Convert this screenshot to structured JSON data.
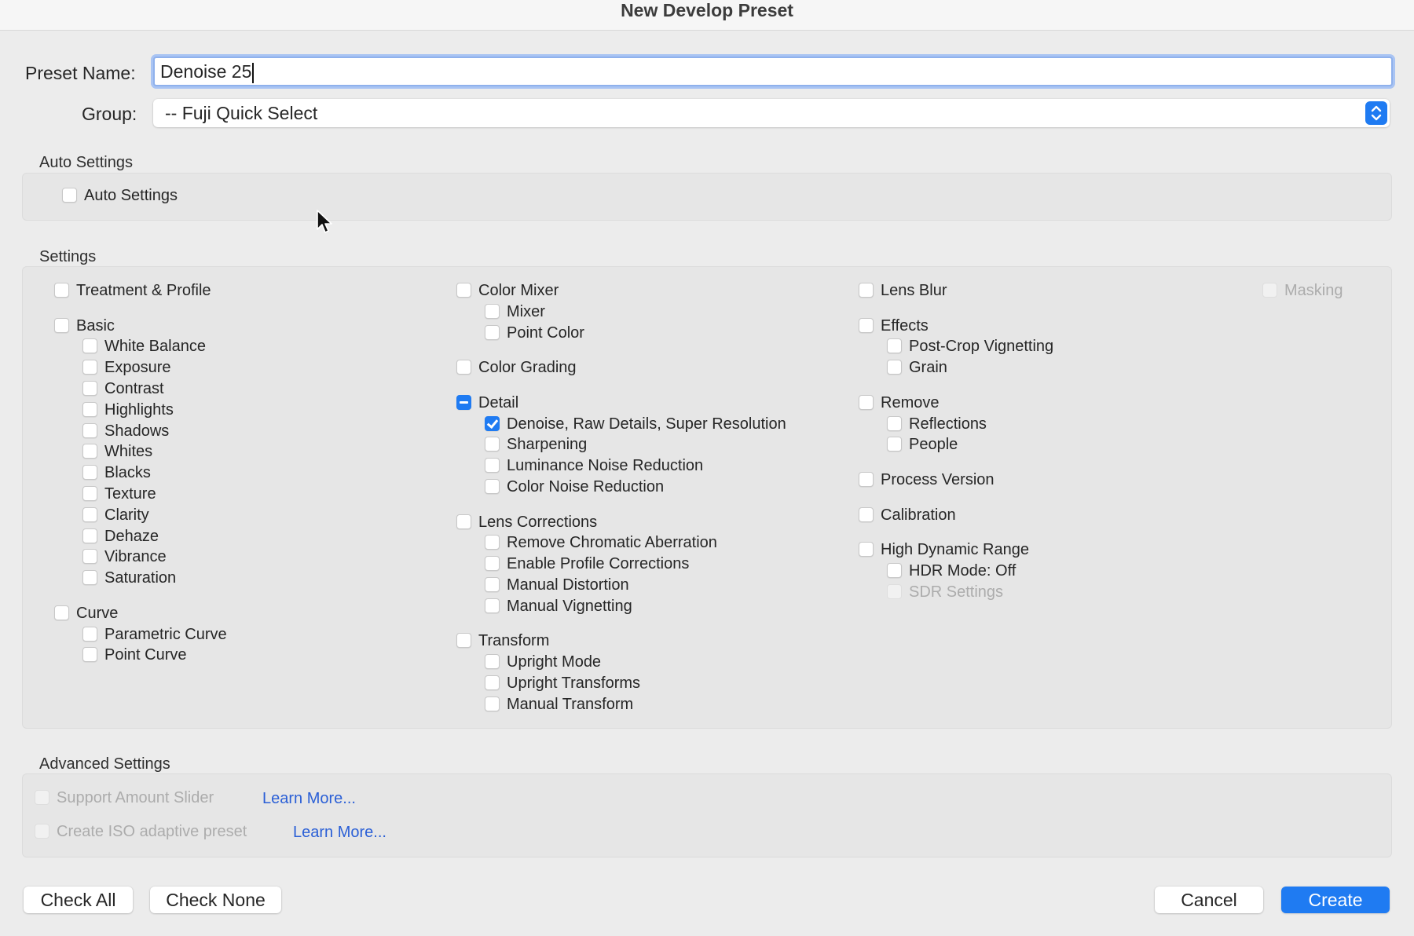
{
  "window": {
    "title": "New Develop Preset"
  },
  "preset_name": {
    "label": "Preset Name:",
    "value": "Denoise 25"
  },
  "group": {
    "label": "Group:",
    "value": "-- Fuji Quick Select"
  },
  "auto_settings": {
    "section_title": "Auto Settings",
    "item": {
      "label": "Auto Settings",
      "checked": false
    }
  },
  "settings": {
    "section_title": "Settings",
    "columns": [
      [
        {
          "label": "Treatment & Profile",
          "level": 0,
          "state": "unchecked"
        },
        {
          "label": "Basic",
          "level": 0,
          "state": "unchecked"
        },
        {
          "label": "White Balance",
          "level": 1,
          "state": "unchecked"
        },
        {
          "label": "Exposure",
          "level": 1,
          "state": "unchecked"
        },
        {
          "label": "Contrast",
          "level": 1,
          "state": "unchecked"
        },
        {
          "label": "Highlights",
          "level": 1,
          "state": "unchecked"
        },
        {
          "label": "Shadows",
          "level": 1,
          "state": "unchecked"
        },
        {
          "label": "Whites",
          "level": 1,
          "state": "unchecked"
        },
        {
          "label": "Blacks",
          "level": 1,
          "state": "unchecked"
        },
        {
          "label": "Texture",
          "level": 1,
          "state": "unchecked"
        },
        {
          "label": "Clarity",
          "level": 1,
          "state": "unchecked"
        },
        {
          "label": "Dehaze",
          "level": 1,
          "state": "unchecked"
        },
        {
          "label": "Vibrance",
          "level": 1,
          "state": "unchecked"
        },
        {
          "label": "Saturation",
          "level": 1,
          "state": "unchecked"
        },
        {
          "label": "Curve",
          "level": 0,
          "state": "unchecked"
        },
        {
          "label": "Parametric Curve",
          "level": 1,
          "state": "unchecked"
        },
        {
          "label": "Point Curve",
          "level": 1,
          "state": "unchecked"
        }
      ],
      [
        {
          "label": "Color Mixer",
          "level": 0,
          "state": "unchecked"
        },
        {
          "label": "Mixer",
          "level": 1,
          "state": "unchecked"
        },
        {
          "label": "Point Color",
          "level": 1,
          "state": "unchecked"
        },
        {
          "label": "Color Grading",
          "level": 0,
          "state": "unchecked"
        },
        {
          "label": "Detail",
          "level": 0,
          "state": "mixed"
        },
        {
          "label": "Denoise, Raw Details, Super Resolution",
          "level": 1,
          "state": "checked"
        },
        {
          "label": "Sharpening",
          "level": 1,
          "state": "unchecked"
        },
        {
          "label": "Luminance Noise Reduction",
          "level": 1,
          "state": "unchecked"
        },
        {
          "label": "Color Noise Reduction",
          "level": 1,
          "state": "unchecked"
        },
        {
          "label": "Lens Corrections",
          "level": 0,
          "state": "unchecked"
        },
        {
          "label": "Remove Chromatic Aberration",
          "level": 1,
          "state": "unchecked"
        },
        {
          "label": "Enable Profile Corrections",
          "level": 1,
          "state": "unchecked"
        },
        {
          "label": "Manual Distortion",
          "level": 1,
          "state": "unchecked"
        },
        {
          "label": "Manual Vignetting",
          "level": 1,
          "state": "unchecked"
        },
        {
          "label": "Transform",
          "level": 0,
          "state": "unchecked"
        },
        {
          "label": "Upright Mode",
          "level": 1,
          "state": "unchecked"
        },
        {
          "label": "Upright Transforms",
          "level": 1,
          "state": "unchecked"
        },
        {
          "label": "Manual Transform",
          "level": 1,
          "state": "unchecked"
        }
      ],
      [
        {
          "label": "Lens Blur",
          "level": 0,
          "state": "unchecked"
        },
        {
          "label": "Effects",
          "level": 0,
          "state": "unchecked"
        },
        {
          "label": "Post-Crop Vignetting",
          "level": 1,
          "state": "unchecked"
        },
        {
          "label": "Grain",
          "level": 1,
          "state": "unchecked"
        },
        {
          "label": "Remove",
          "level": 0,
          "state": "unchecked"
        },
        {
          "label": "Reflections",
          "level": 1,
          "state": "unchecked"
        },
        {
          "label": "People",
          "level": 1,
          "state": "unchecked"
        },
        {
          "label": "Process Version",
          "level": 0,
          "state": "unchecked"
        },
        {
          "label": "Calibration",
          "level": 0,
          "state": "unchecked"
        },
        {
          "label": "High Dynamic Range",
          "level": 0,
          "state": "unchecked"
        },
        {
          "label": "HDR Mode: Off",
          "level": 1,
          "state": "unchecked"
        },
        {
          "label": "SDR Settings",
          "level": 1,
          "state": "disabled"
        }
      ],
      [
        {
          "label": "Masking",
          "level": 0,
          "state": "disabled"
        }
      ]
    ]
  },
  "advanced_settings": {
    "section_title": "Advanced Settings",
    "support_amount_slider": {
      "label": "Support Amount Slider",
      "link": "Learn More..."
    },
    "iso_adaptive": {
      "label": "Create ISO adaptive preset",
      "link": "Learn More..."
    }
  },
  "buttons": {
    "check_all": "Check All",
    "check_none": "Check None",
    "cancel": "Cancel",
    "create": "Create"
  },
  "colors": {
    "accent": "#1f7bf2",
    "link": "#2a5fd6"
  }
}
